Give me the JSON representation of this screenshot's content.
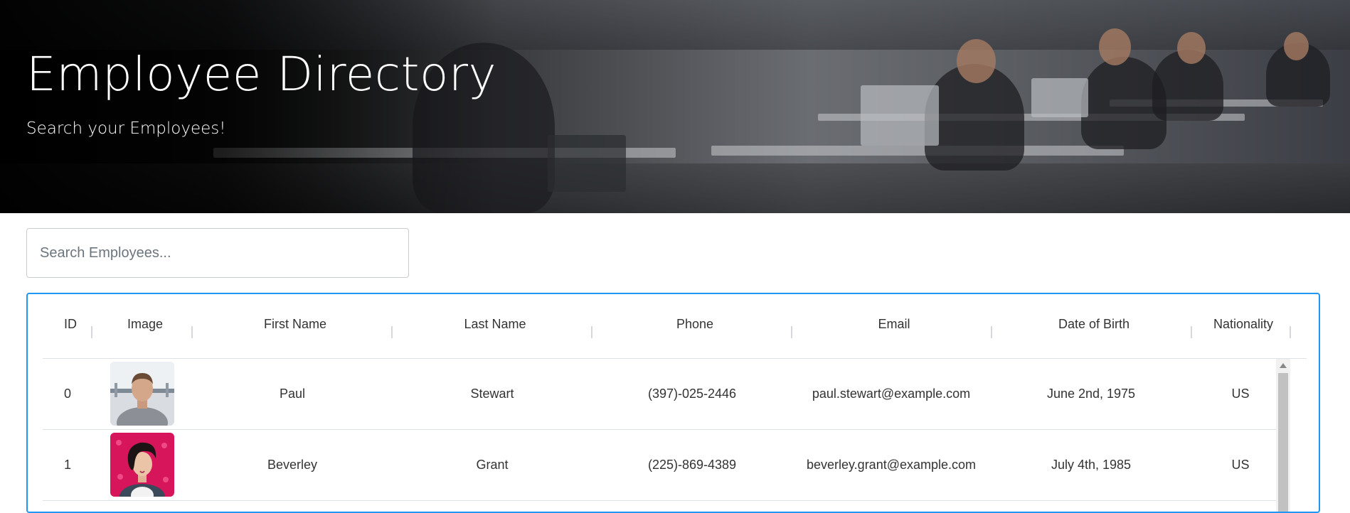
{
  "header": {
    "title": "Employee Directory",
    "subtitle": "Search your Employees!"
  },
  "search": {
    "placeholder": "Search Employees..."
  },
  "table": {
    "columns": [
      "ID",
      "Image",
      "First Name",
      "Last Name",
      "Phone",
      "Email",
      "Date of Birth",
      "Nationality"
    ],
    "rows": [
      {
        "id": "0",
        "image": "portrait-man-short-hair-gray-shirt",
        "first_name": "Paul",
        "last_name": "Stewart",
        "phone": "(397)-025-2446",
        "email": "paul.stewart@example.com",
        "dob": "June 2nd, 1975",
        "nationality": "US"
      },
      {
        "id": "1",
        "image": "portrait-woman-curly-hair-pink-background",
        "first_name": "Beverley",
        "last_name": "Grant",
        "phone": "(225)-869-4389",
        "email": "beverley.grant@example.com",
        "dob": "July 4th, 1985",
        "nationality": "US"
      }
    ]
  },
  "colors": {
    "accent_border": "#2196f3",
    "text": "#333333"
  }
}
